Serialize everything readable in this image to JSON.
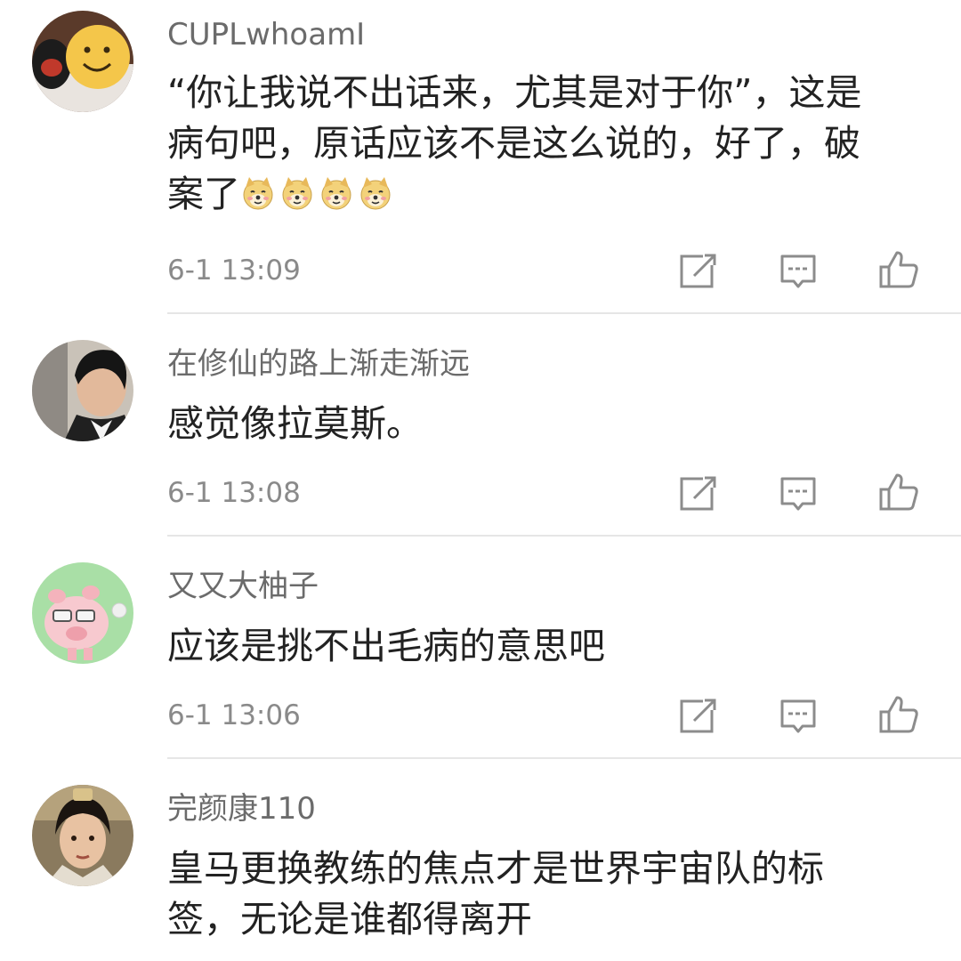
{
  "comments": [
    {
      "username": "CUPLwhoamI",
      "text_lines": [
        "“你让我说不出话来，尤其是对于你”，这是",
        "病句吧，原话应该不是这么说的，好了，破",
        "案了"
      ],
      "emoji_count": 4,
      "emoji_icon": "doge-emoji-icon",
      "time": "6-1 13:09",
      "avatar_icon": "smiley-avatar-icon"
    },
    {
      "username": "在修仙的路上渐走渐远",
      "text_lines": [
        "感觉像拉莫斯。"
      ],
      "time": "6-1 13:08",
      "avatar_icon": "man-photo-avatar-icon"
    },
    {
      "username": "又又大柚子",
      "text_lines": [
        "应该是挑不出毛病的意思吧"
      ],
      "time": "6-1 13:06",
      "avatar_icon": "pig-avatar-icon"
    },
    {
      "username": "完颜康110",
      "text_lines": [
        "皇马更换教练的焦点才是世界宇宙队的标",
        "签，无论是谁都得离开"
      ],
      "avatar_icon": "costume-man-avatar-icon"
    }
  ],
  "icons": {
    "repost": "share-edit-icon",
    "reply": "comment-icon",
    "like": "thumbs-up-icon"
  },
  "colors": {
    "username": "#6b6b6b",
    "text": "#222222",
    "time": "#8a8a8a",
    "icon": "#8c8c8c",
    "divider": "#e6e6e6"
  }
}
